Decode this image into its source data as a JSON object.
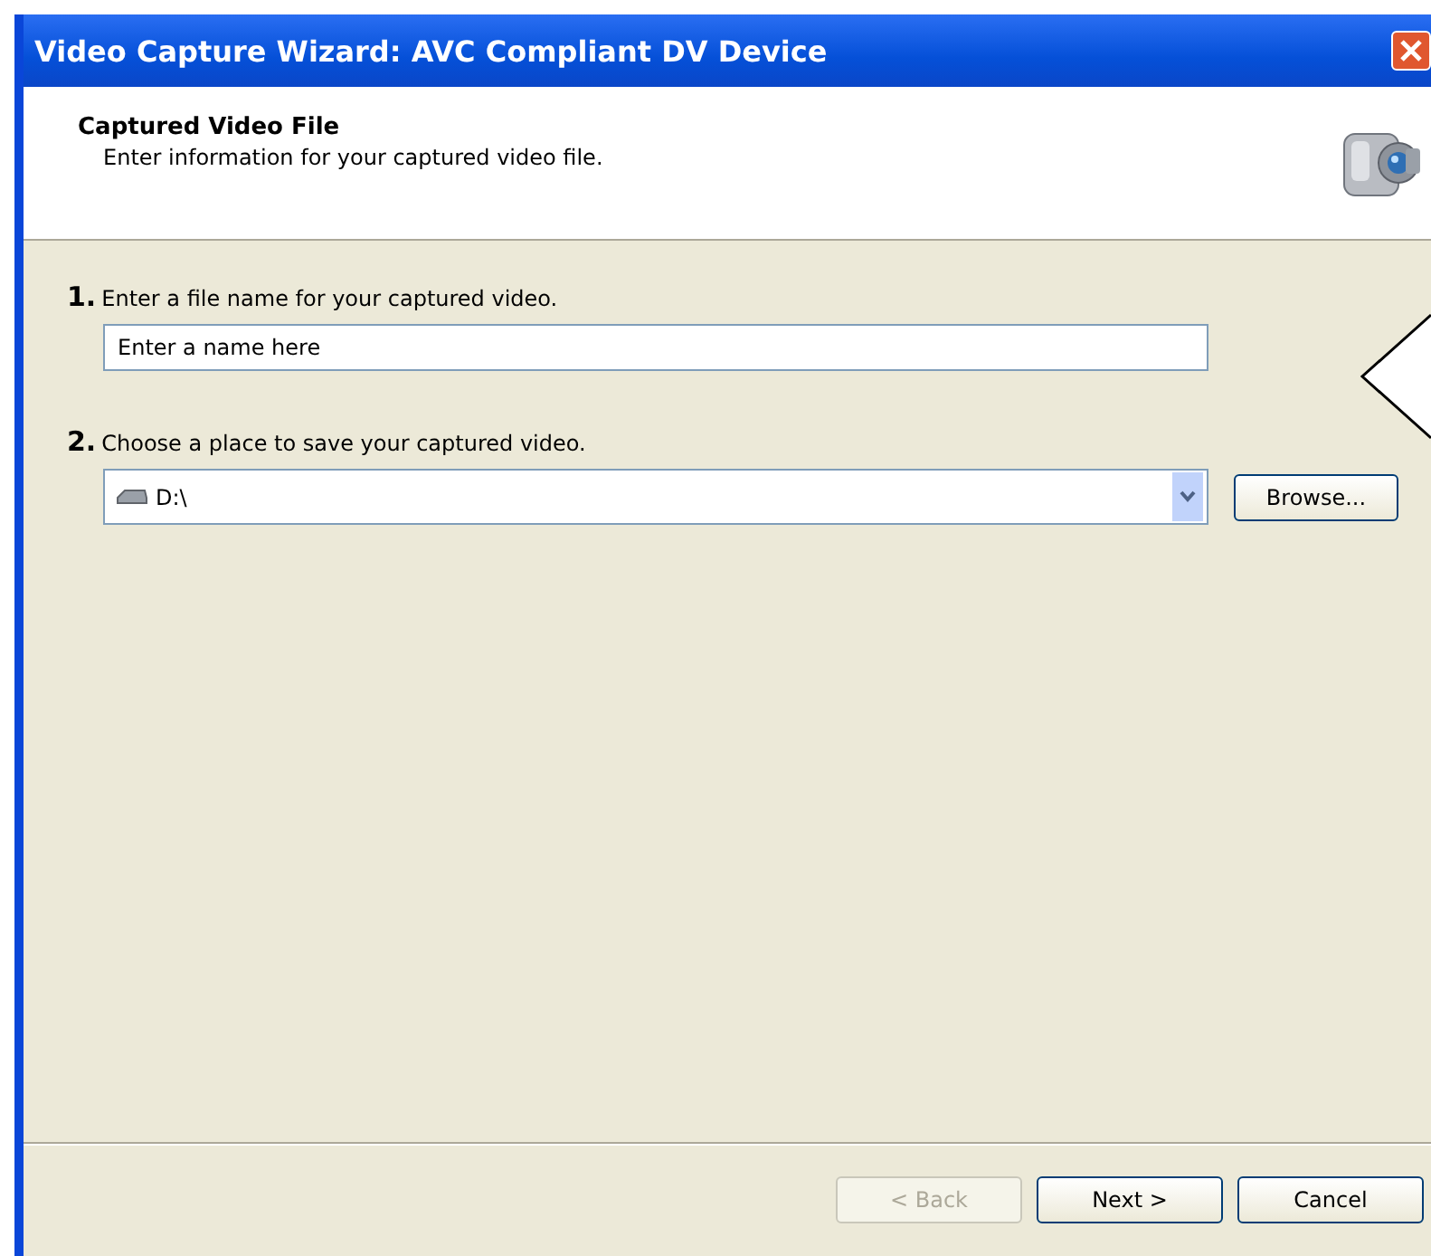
{
  "window": {
    "title": "Video Capture Wizard: AVC Compliant DV Device"
  },
  "header": {
    "title": "Captured Video File",
    "subtitle": "Enter information for your captured video file."
  },
  "steps": [
    {
      "number": "1.",
      "label": "Enter a file name for your captured video.",
      "kind": "text",
      "value": "Enter a name here"
    },
    {
      "number": "2.",
      "label": "Choose a place to save your captured video.",
      "kind": "combo",
      "value": "D:\\",
      "button": "Browse..."
    }
  ],
  "buttons": [
    {
      "label": "< Back",
      "disabled": true
    },
    {
      "label": "Next >",
      "disabled": false
    },
    {
      "label": "Cancel",
      "disabled": false
    }
  ]
}
